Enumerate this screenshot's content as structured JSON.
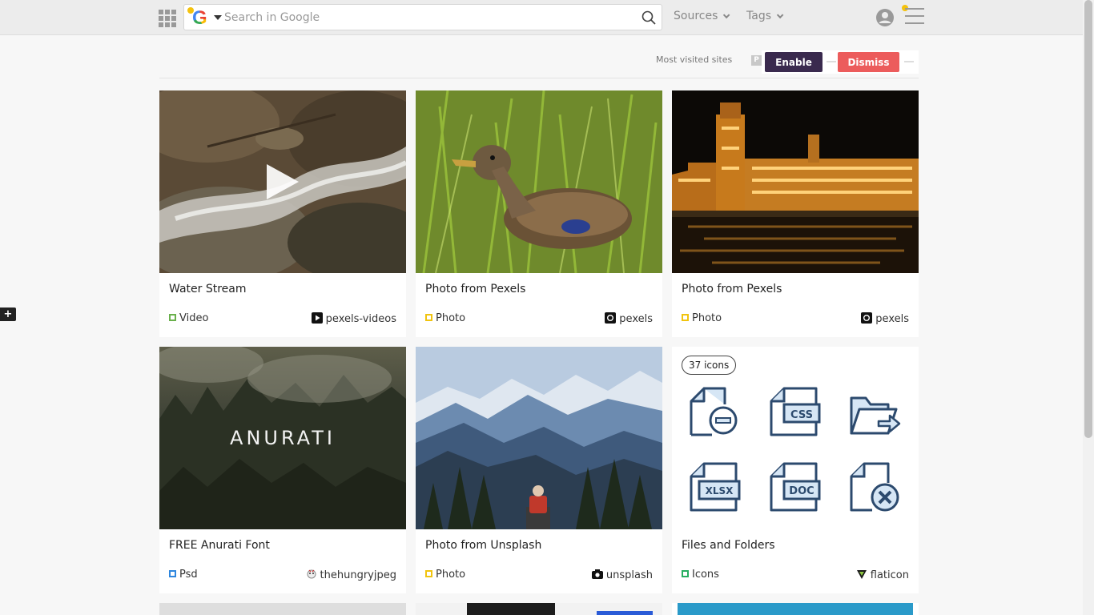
{
  "search": {
    "placeholder": "Search in Google"
  },
  "nav": {
    "sources": "Sources",
    "tags": "Tags"
  },
  "most_visited": {
    "label": "Most visited sites",
    "p_badge": "P",
    "enable": "Enable",
    "dismiss": "Dismiss"
  },
  "side": {
    "plus": "+"
  },
  "cards": [
    {
      "title": "Water Stream",
      "type": "Video",
      "type_color": "#6ab04c",
      "source": "pexels-videos"
    },
    {
      "title": "Photo from Pexels",
      "type": "Photo",
      "type_color": "#f1c40f",
      "source": "pexels"
    },
    {
      "title": "Photo from Pexels",
      "type": "Photo",
      "type_color": "#f1c40f",
      "source": "pexels"
    },
    {
      "title": "FREE Anurati Font",
      "type": "Psd",
      "type_color": "#2e86de",
      "source": "thehungryjpeg",
      "thumb_text": "ANURATI"
    },
    {
      "title": "Photo from Unsplash",
      "type": "Photo",
      "type_color": "#f1c40f",
      "source": "unsplash"
    },
    {
      "title": "Files and Folders",
      "type": "Icons",
      "type_color": "#27ae60",
      "source": "flaticon",
      "badge": "37 icons",
      "file_labels": [
        "CSS",
        "XLSX",
        "DOC"
      ]
    }
  ],
  "colors": {
    "topbar": "#ececec",
    "enable": "#3a2a4e",
    "dismiss": "#ec5c5c",
    "icon_blue": "#2c4a6e"
  }
}
